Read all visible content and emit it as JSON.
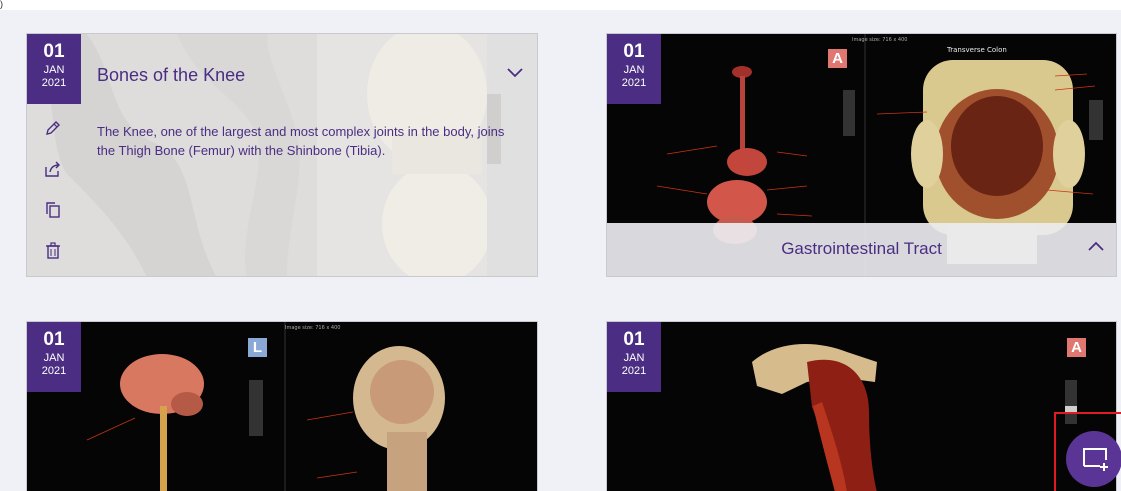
{
  "topbar": {
    "mark": ")"
  },
  "cards": [
    {
      "date": {
        "day": "01",
        "month": "JAN",
        "year": "2021"
      },
      "title": "Bones of the Knee",
      "description": "The Knee, one of the largest and most complex joints in the body, joins the Thigh Bone (Femur) with the Shinbone (Tibia).",
      "actions": [
        "edit-icon",
        "share-icon",
        "copy-icon",
        "delete-icon"
      ],
      "expanded": true
    },
    {
      "date": {
        "day": "01",
        "month": "JAN",
        "year": "2021"
      },
      "title": "Gastrointestinal Tract",
      "badge": "A",
      "image_caption": "Transverse Colon",
      "image_size_label": "Image size: 716 x 400"
    },
    {
      "date": {
        "day": "01",
        "month": "JAN",
        "year": "2021"
      },
      "badge": "L",
      "image_size_label": "Image size: 716 x 400"
    },
    {
      "date": {
        "day": "01",
        "month": "JAN",
        "year": "2021"
      },
      "badge": "A"
    }
  ],
  "fab": {
    "icon": "new-screenshot-icon"
  },
  "colors": {
    "brand_purple": "#4b2d83",
    "fab_purple": "#5a3596",
    "highlight_red": "#e01b24"
  }
}
